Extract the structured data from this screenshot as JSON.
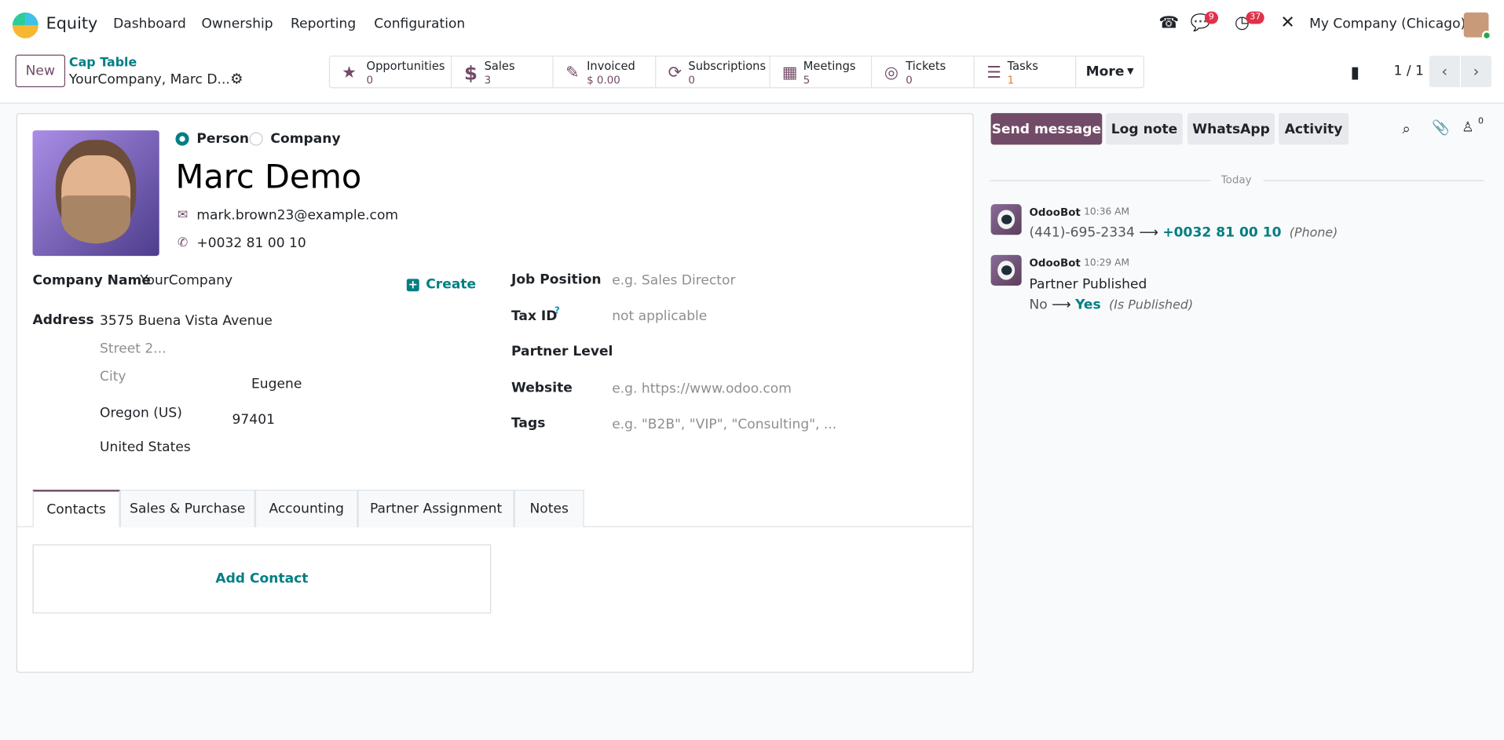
{
  "navbar": {
    "app_name": "Equity",
    "menu": [
      "Dashboard",
      "Ownership",
      "Reporting",
      "Configuration"
    ],
    "messages_badge": "9",
    "activities_badge": "37",
    "company": "My Company (Chicago)"
  },
  "control_panel": {
    "new_label": "New",
    "breadcrumb_parent": "Cap Table",
    "breadcrumb_current": "YourCompany, Marc D...",
    "pager": "1 / 1"
  },
  "smart_buttons": [
    {
      "label": "Opportunities",
      "value": "0",
      "icon": "star-icon"
    },
    {
      "label": "Sales",
      "value": "3",
      "icon": "dollar-icon"
    },
    {
      "label": "Invoiced",
      "value": "$ 0.00",
      "icon": "edit-icon"
    },
    {
      "label": "Subscriptions",
      "value": "0",
      "icon": "refresh-icon"
    },
    {
      "label": "Meetings",
      "value": "5",
      "icon": "calendar-icon"
    },
    {
      "label": "Tickets",
      "value": "0",
      "icon": "lifebuoy-icon"
    },
    {
      "label": "Tasks",
      "value": "1",
      "icon": "tasks-icon"
    }
  ],
  "more_label": "More",
  "form": {
    "type_person": "Person",
    "type_company": "Company",
    "name": "Marc Demo",
    "email": "mark.brown23@example.com",
    "phone": "+0032 81 00 10",
    "company_name_label": "Company Name",
    "company_name": "YourCompany",
    "create_label": "Create",
    "address_label": "Address",
    "street": "3575  Buena Vista Avenue",
    "street2_placeholder": "Street 2...",
    "city_placeholder": "City",
    "city": "Eugene",
    "state": "Oregon (US)",
    "zip": "97401",
    "country": "United States",
    "job_label": "Job Position",
    "job_placeholder": "e.g. Sales Director",
    "tax_label": "Tax ID",
    "tax_help": "?",
    "tax_placeholder": "not applicable",
    "level_label": "Partner Level",
    "website_label": "Website",
    "website_placeholder": "e.g. https://www.odoo.com",
    "tags_label": "Tags",
    "tags_placeholder": "e.g. \"B2B\", \"VIP\", \"Consulting\", ...",
    "tabs": [
      "Contacts",
      "Sales & Purchase",
      "Accounting",
      "Partner Assignment",
      "Notes"
    ],
    "add_contact": "Add Contact"
  },
  "chatter": {
    "send_message": "Send message",
    "log_note": "Log note",
    "whatsapp": "WhatsApp",
    "activity": "Activity",
    "followers_count": "0",
    "date_sep": "Today",
    "messages": [
      {
        "author": "OdooBot",
        "time": "10:36 AM",
        "old": "(441)-695-2334",
        "new": "+0032 81 00 10",
        "field": "(Phone)"
      },
      {
        "author": "OdooBot",
        "time": "10:29 AM",
        "title": "Partner Published",
        "old": "No",
        "new": "Yes",
        "field": "(Is Published)"
      }
    ]
  },
  "colors": {
    "brand": "#714b67",
    "teal": "#017e84"
  }
}
